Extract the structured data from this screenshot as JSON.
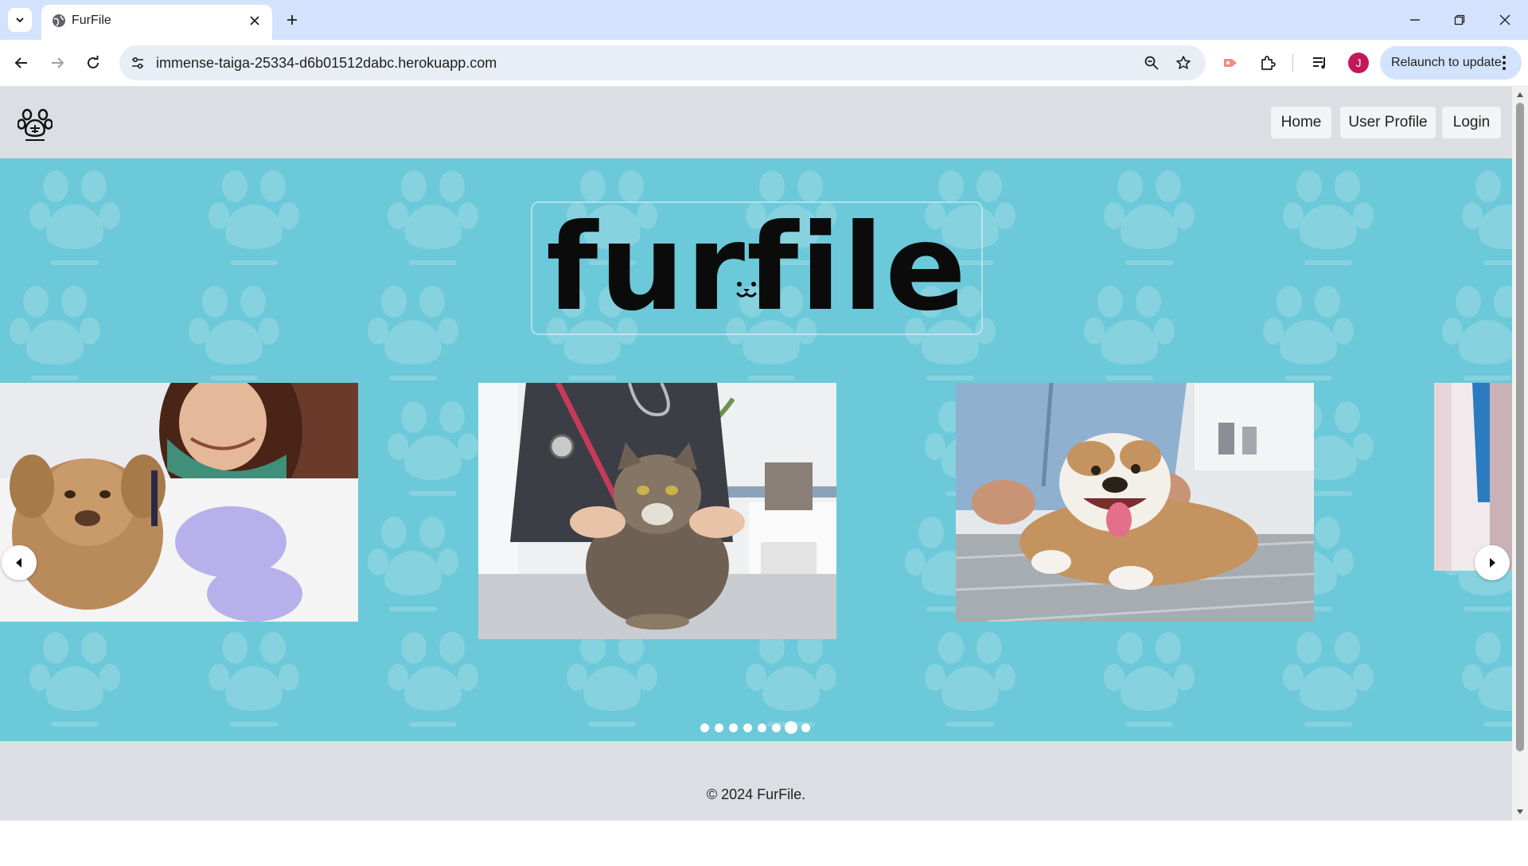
{
  "browser": {
    "tab_title": "FurFile",
    "url": "immense-taiga-25334-d6b01512dabc.herokuapp.com",
    "profile_initial": "J",
    "relaunch_label": "Relaunch to update"
  },
  "site": {
    "brand_text": "furfile",
    "nav": [
      {
        "label": "Home"
      },
      {
        "label": "User Profile"
      },
      {
        "label": "Login"
      }
    ],
    "carousel": {
      "slides": [
        {
          "subject": "vet-with-puppy"
        },
        {
          "subject": "vet-with-cat"
        },
        {
          "subject": "vet-with-bulldog"
        },
        {
          "subject": "partial-next-slide"
        }
      ],
      "dots_total": 8,
      "active_dot": 7
    },
    "footer_text": "© 2024 FurFile."
  },
  "colors": {
    "hero_bg": "#6cc9d9",
    "header_bg": "#dbdee2",
    "tabstrip_bg": "#d3e3fd"
  }
}
